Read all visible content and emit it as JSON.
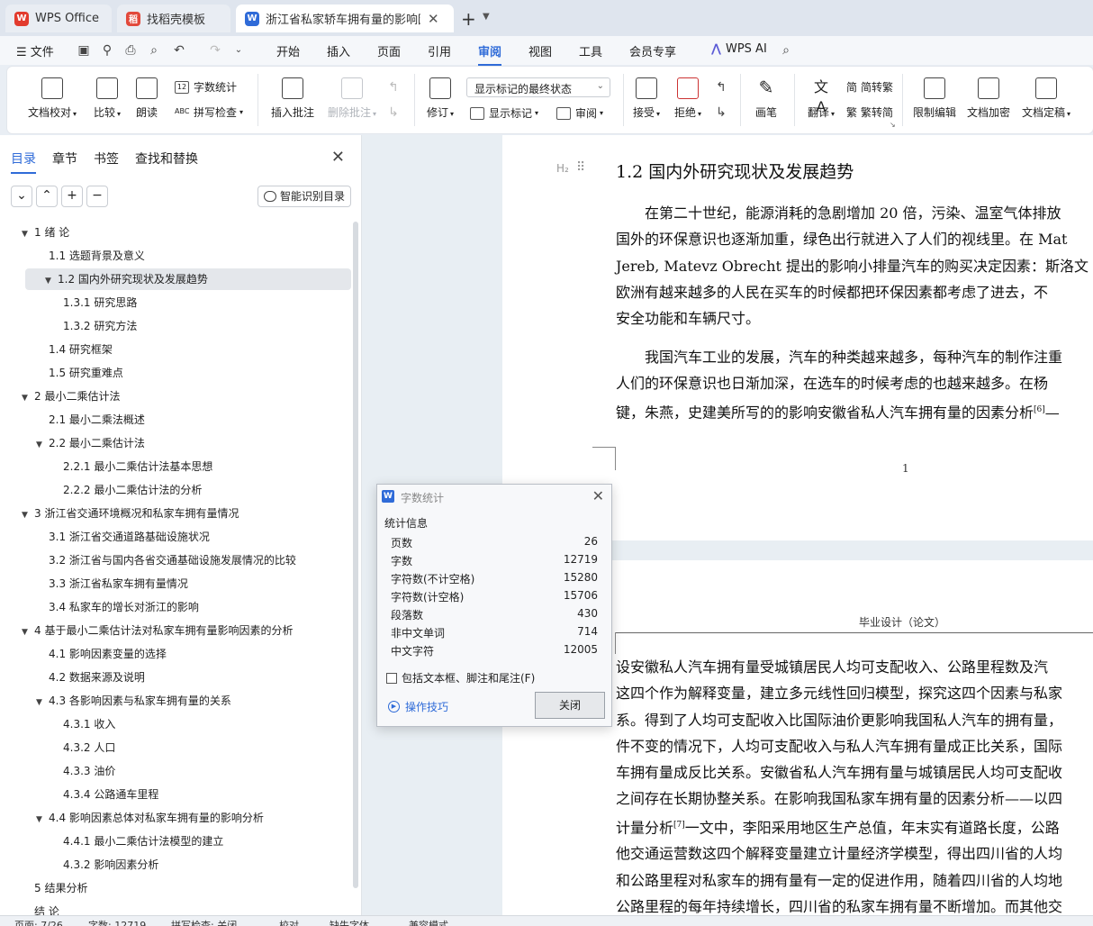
{
  "tabs": {
    "wps": "WPS Office",
    "daoke": "找稻壳模板",
    "doc": "浙江省私家轿车拥有量的影响因素"
  },
  "menu": {
    "file": "文件",
    "items": [
      "开始",
      "插入",
      "页面",
      "引用",
      "审阅",
      "视图",
      "工具",
      "会员专享"
    ],
    "active": "审阅",
    "wps_ai": "WPS AI"
  },
  "ribbon": {
    "doc_check": "文档校对",
    "compare": "比较",
    "read_aloud": "朗读",
    "word_count": "字数统计",
    "spell_check": "拼写检查",
    "insert_comment": "插入批注",
    "delete_comment": "删除批注",
    "revise": "修订",
    "markup_state": "显示标记的最终状态",
    "show_markup": "显示标记",
    "review_pane": "审阅",
    "accept": "接受",
    "reject": "拒绝",
    "ink": "画笔",
    "translate": "翻译",
    "to_trad": "简转繁",
    "to_simp": "繁转简",
    "restrict_edit": "限制编辑",
    "encrypt": "文档加密",
    "finalize": "文档定稿"
  },
  "nav": {
    "tabs": [
      "目录",
      "章节",
      "书签",
      "查找和替换"
    ],
    "smart_toc": "智能识别目录",
    "toc": [
      {
        "text": "1  绪  论",
        "level": 1,
        "expanded": true
      },
      {
        "text": "1.1  选题背景及意义",
        "level": 2
      },
      {
        "text": "1.2  国内外研究现状及发展趋势",
        "level": 2,
        "expanded": true,
        "selected": true
      },
      {
        "text": "1.3.1  研究思路",
        "level": 3
      },
      {
        "text": "1.3.2  研究方法",
        "level": 3
      },
      {
        "text": "1.4  研究框架",
        "level": 2
      },
      {
        "text": "1.5  研究重难点",
        "level": 2
      },
      {
        "text": "2  最小二乘估计法",
        "level": 1,
        "expanded": true
      },
      {
        "text": "2.1  最小二乘法概述",
        "level": 2
      },
      {
        "text": "2.2  最小二乘估计法",
        "level": 2,
        "expanded": true
      },
      {
        "text": "2.2.1  最小二乘估计法基本思想",
        "level": 3
      },
      {
        "text": "2.2.2  最小二乘估计法的分析",
        "level": 3
      },
      {
        "text": "3  浙江省交通环境概况和私家车拥有量情况",
        "level": 1,
        "expanded": true
      },
      {
        "text": "3.1  浙江省交通道路基础设施状况",
        "level": 2
      },
      {
        "text": "3.2  浙江省与国内各省交通基础设施发展情况的比较",
        "level": 2
      },
      {
        "text": "3.3  浙江省私家车拥有量情况",
        "level": 2
      },
      {
        "text": "3.4  私家车的增长对浙江的影响",
        "level": 2
      },
      {
        "text": "4  基于最小二乘估计法对私家车拥有量影响因素的分析",
        "level": 1,
        "expanded": true
      },
      {
        "text": "4.1  影响因素变量的选择",
        "level": 2
      },
      {
        "text": "4.2  数据来源及说明",
        "level": 2
      },
      {
        "text": "4.3  各影响因素与私家车拥有量的关系",
        "level": 2,
        "expanded": true
      },
      {
        "text": "4.3.1  收入",
        "level": 3
      },
      {
        "text": "4.3.2  人口",
        "level": 3
      },
      {
        "text": "4.3.3  油价",
        "level": 3
      },
      {
        "text": "4.3.4  公路通车里程",
        "level": 3
      },
      {
        "text": "4.4  影响因素总体对私家车拥有量的影响分析",
        "level": 2,
        "expanded": true
      },
      {
        "text": "4.4.1  最小二乘估计法模型的建立",
        "level": 3
      },
      {
        "text": "4.3.2  影响因素分析",
        "level": 3
      },
      {
        "text": "5  结果分析",
        "level": 1
      },
      {
        "text": "结  论",
        "level": 1
      }
    ]
  },
  "doc": {
    "heading_marker": "H₂",
    "heading": "1.2  国内外研究现状及发展趋势",
    "p1": [
      "　　在第二十世纪，能源消耗的急剧增加 20 倍，污染、温室气体排放",
      "国外的环保意识也逐渐加重，绿色出行就进入了人们的视线里。在 Mat",
      "Jereb, Matevz Obrecht 提出的影响小排量汽车的购买决定因素：斯洛文",
      "欧洲有越来越多的人民在买车的时候都把环保因素都考虑了进去，不",
      "安全功能和车辆尺寸。"
    ],
    "p2": [
      "　　我国汽车工业的发展，汽车的种类越来越多，每种汽车的制作注重",
      "人们的环保意识也日渐加深，在选车的时候考虑的也越来越多。在杨",
      "键，朱燕，史建美所写的的影响安徽省私人汽车拥有量的因素分析",
      "[6]",
      "—"
    ],
    "page_number": "1",
    "page2_header": "毕业设计（论文）",
    "p3": [
      "设安徽私人汽车拥有量受城镇居民人均可支配收入、公路里程数及汽",
      "这四个作为解释变量，建立多元线性回归模型，探究这四个因素与私家",
      "系。得到了人均可支配收入比国际油价更影响我国私人汽车的拥有量，",
      "件不变的情况下，人均可支配收入与私人汽车拥有量成正比关系，国际",
      "车拥有量成反比关系。安徽省私人汽车拥有量与城镇居民人均可支配收",
      "之间存在长期协整关系。在影响我国私家车拥有量的因素分析——以四",
      "计量分析",
      "[7]",
      "一文中，李阳采用地区生产总值，年末实有道路长度，公路",
      "他交通运营数这四个解释变量建立计量经济学模型，得出四川省的人均",
      "和公路里程对私家车的拥有量有一定的促进作用，随着四川省的人均地",
      "公路里程的每年持续增长，四川省的私家车拥有量不断增加。而其他交"
    ]
  },
  "word_count_dialog": {
    "title": "字数统计",
    "group": "统计信息",
    "rows": [
      {
        "label": "页数",
        "value": "26"
      },
      {
        "label": "字数",
        "value": "12719"
      },
      {
        "label": "字符数(不计空格)",
        "value": "15280"
      },
      {
        "label": "字符数(计空格)",
        "value": "15706"
      },
      {
        "label": "段落数",
        "value": "430"
      },
      {
        "label": "非中文单词",
        "value": "714"
      },
      {
        "label": "中文字符",
        "value": "12005"
      }
    ],
    "include_label": "包括文本框、脚注和尾注(F)",
    "tips": "操作技巧",
    "close": "关闭"
  },
  "status": {
    "page": "页面: 7/26",
    "words": "字数: 12719",
    "spell": "拼写检查: 关闭",
    "proof": "校对",
    "missing_font": "缺失字体",
    "compat": "兼容模式"
  },
  "colors": {
    "accent": "#2f6bd8",
    "wps_red": "#e23b2e"
  }
}
